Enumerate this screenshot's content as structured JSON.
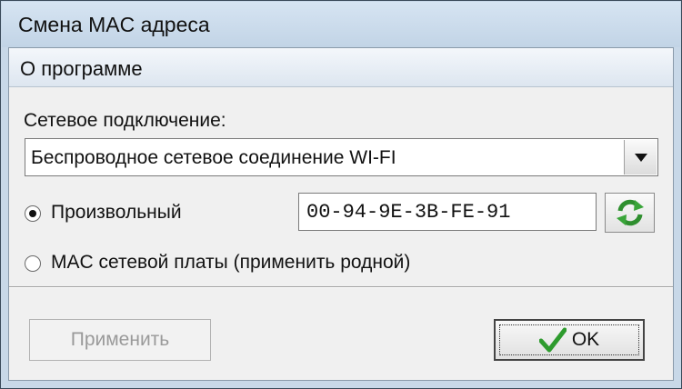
{
  "window": {
    "title": "Смена MAC адреса"
  },
  "menu": {
    "items": [
      {
        "label": "О программе"
      }
    ]
  },
  "connection": {
    "label": "Сетевое подключение:",
    "selected": "Беспроводное сетевое соединение WI-FI"
  },
  "mode": {
    "random_label": "Произвольный",
    "random_selected": true,
    "original_label": "MAC сетевой платы (применить родной)",
    "original_selected": false
  },
  "mac": {
    "value": "00-94-9E-3B-FE-91"
  },
  "buttons": {
    "apply_label": "Применить",
    "apply_enabled": false,
    "ok_label": "OK"
  },
  "icons": {
    "refresh": "refresh-icon",
    "checkmark": "checkmark-icon",
    "dropdown": "chevron-down-icon"
  },
  "colors": {
    "refresh_green": "#3aa53a",
    "check_green": "#2e9b2e",
    "disabled_text": "#9a9a9a"
  }
}
